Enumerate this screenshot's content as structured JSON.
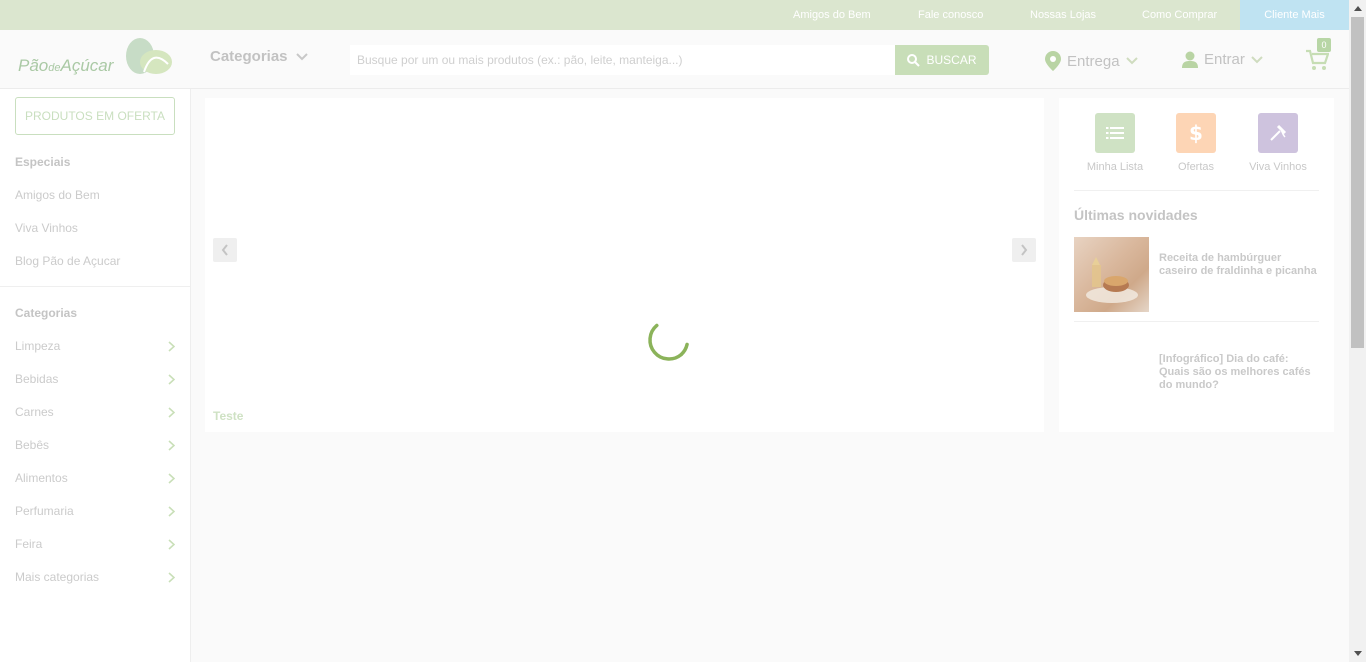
{
  "topbar": {
    "links": [
      "Amigos do Bem",
      "Fale conosco",
      "Nossas Lojas",
      "Como Comprar"
    ],
    "cliente_mais": "Cliente Mais"
  },
  "header": {
    "logo_pre": "Pão",
    "logo_de": "de",
    "logo_post": "Açúcar",
    "categorias_label": "Categorias",
    "search_placeholder": "Busque por um ou mais produtos (ex.: pão, leite, manteiga...)",
    "search_button": "BUSCAR",
    "entrega_label": "Entrega",
    "entrar_label": "Entrar",
    "cart_count": "0"
  },
  "sidebar": {
    "offer_button": "PRODUTOS EM OFERTA",
    "especiais_title": "Especiais",
    "especiais": [
      "Amigos do Bem",
      "Viva Vinhos",
      "Blog Pão de Açucar"
    ],
    "categorias_title": "Categorias",
    "categorias": [
      "Limpeza",
      "Bebidas",
      "Carnes",
      "Bebês",
      "Alimentos",
      "Perfumaria",
      "Feira",
      "Mais categorias"
    ]
  },
  "banner": {
    "caption": "Teste"
  },
  "right_panel": {
    "quick_links": [
      {
        "label": "Minha Lista",
        "icon": "list-icon",
        "color": "#cfe2c4"
      },
      {
        "label": "Ofertas",
        "icon": "dollar-icon",
        "color": "#fdd5b5"
      },
      {
        "label": "Viva Vinhos",
        "icon": "corkscrew-icon",
        "color": "#cec3de"
      }
    ],
    "news_title": "Últimas novidades",
    "news": [
      "Receita de hambúrguer caseiro de fraldinha e picanha",
      "[Infográfico] Dia do café: Quais são os melhores cafés do mundo?"
    ]
  },
  "colors": {
    "topbar_bg": "#dbe6cf",
    "cliente_mais_bg": "#bfe3f2",
    "accent_green": "#c8deb8",
    "spinner": "#8bb35a"
  }
}
